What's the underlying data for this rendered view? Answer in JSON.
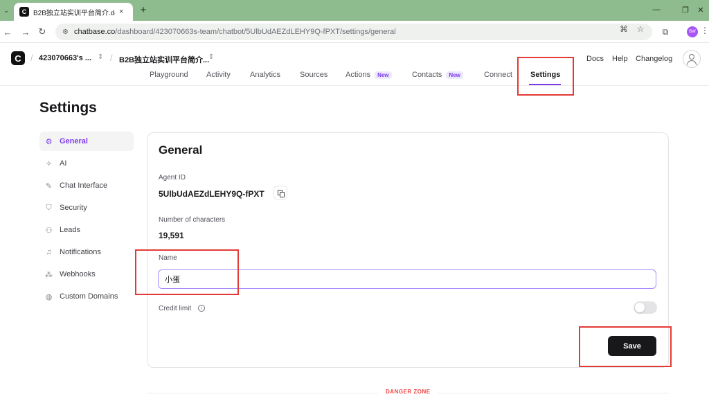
{
  "browser": {
    "tab_title": "B2B独立站实训平台简介.docx",
    "tab_close": "×",
    "new_tab": "+",
    "url_host": "chatbase.co",
    "url_path": "/dashboard/423070663s-team/chatbot/5UlbUdAEZdLEHY9Q-fPXT/settings/general",
    "profile_initials": "BW"
  },
  "header": {
    "logo_letter": "C",
    "workspace": "423070663's ...",
    "agent": "B2B独立站实训平台简介...",
    "links": [
      "Docs",
      "Help",
      "Changelog"
    ]
  },
  "tabs": [
    {
      "label": "Playground"
    },
    {
      "label": "Activity"
    },
    {
      "label": "Analytics"
    },
    {
      "label": "Sources"
    },
    {
      "label": "Actions",
      "badge": "New"
    },
    {
      "label": "Contacts",
      "badge": "New"
    },
    {
      "label": "Connect"
    },
    {
      "label": "Settings",
      "active": true
    }
  ],
  "page": {
    "title": "Settings"
  },
  "sidebar": {
    "items": [
      {
        "label": "General",
        "icon": "gear-icon",
        "active": true
      },
      {
        "label": "AI",
        "icon": "sparkles-icon"
      },
      {
        "label": "Chat Interface",
        "icon": "brush-icon"
      },
      {
        "label": "Security",
        "icon": "shield-icon"
      },
      {
        "label": "Leads",
        "icon": "users-icon"
      },
      {
        "label": "Notifications",
        "icon": "bell-icon"
      },
      {
        "label": "Webhooks",
        "icon": "webhook-icon"
      },
      {
        "label": "Custom Domains",
        "icon": "globe-icon"
      }
    ]
  },
  "general": {
    "title": "General",
    "agent_id_label": "Agent ID",
    "agent_id": "5UlbUdAEZdLEHY9Q-fPXT",
    "characters_label": "Number of characters",
    "characters": "19,591",
    "name_label": "Name",
    "name_value": "小蛋",
    "credit_label": "Credit limit",
    "credit_enabled": false,
    "save_label": "Save"
  },
  "danger": {
    "label": "DANGER ZONE"
  },
  "colors": {
    "accent": "#7c3aed",
    "chrome": "#8fbc8f",
    "highlight": "#e53935",
    "danger": "#ef4444"
  }
}
